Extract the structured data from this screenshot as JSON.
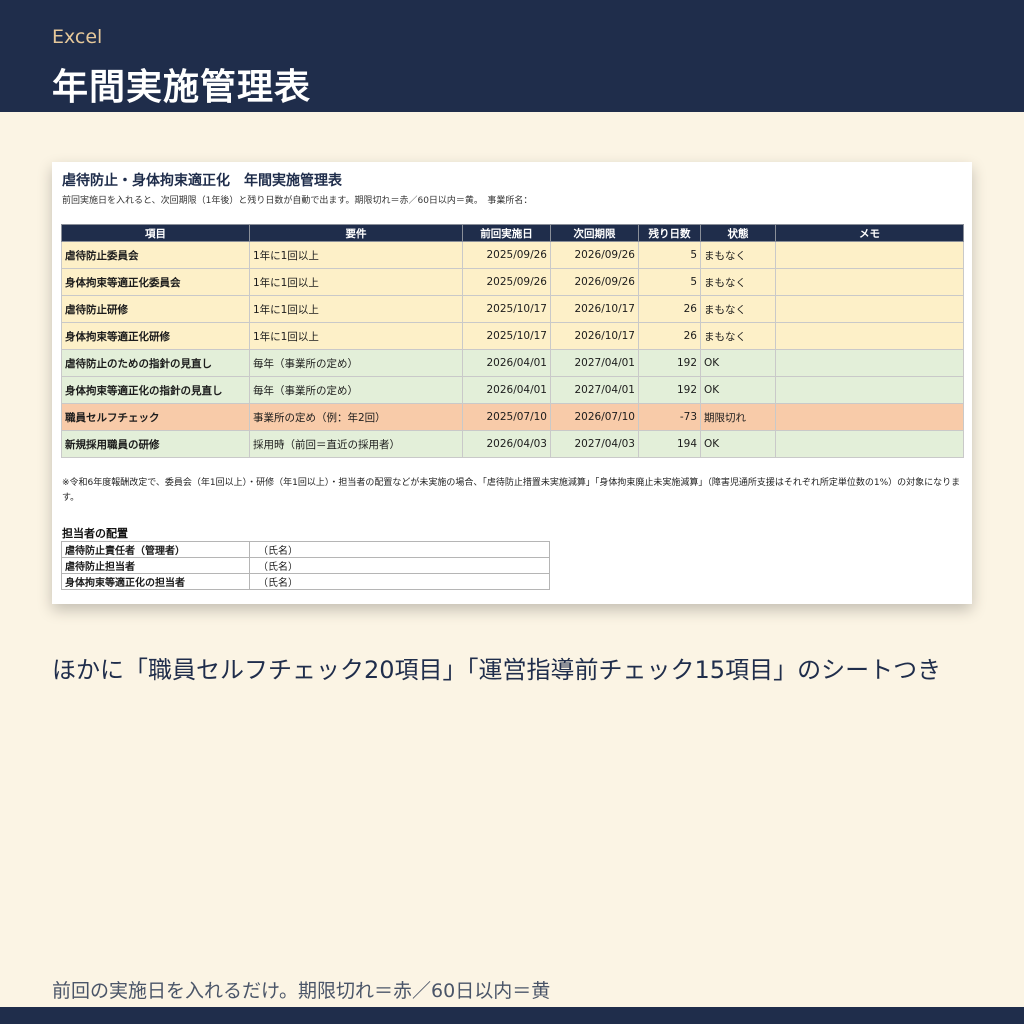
{
  "header": {
    "app": "Excel",
    "title": "年間実施管理表"
  },
  "sheet": {
    "title": "虐待防止・身体拘束適正化　年間実施管理表",
    "subtitle": "前回実施日を入れると、次回期限（1年後）と残り日数が自動で出ます。期限切れ＝赤／60日以内＝黄。　事業所名：",
    "columns": [
      "項目",
      "要件",
      "前回実施日",
      "次回期限",
      "残り日数",
      "状態",
      "メモ"
    ],
    "rows": [
      {
        "item": "虐待防止委員会",
        "req": "1年に1回以上",
        "last": "2025/09/26",
        "next": "2026/09/26",
        "days": "5",
        "status": "まもなく",
        "memo": "",
        "level": "y"
      },
      {
        "item": "身体拘束等適正化委員会",
        "req": "1年に1回以上",
        "last": "2025/09/26",
        "next": "2026/09/26",
        "days": "5",
        "status": "まもなく",
        "memo": "",
        "level": "y"
      },
      {
        "item": "虐待防止研修",
        "req": "1年に1回以上",
        "last": "2025/10/17",
        "next": "2026/10/17",
        "days": "26",
        "status": "まもなく",
        "memo": "",
        "level": "y"
      },
      {
        "item": "身体拘束等適正化研修",
        "req": "1年に1回以上",
        "last": "2025/10/17",
        "next": "2026/10/17",
        "days": "26",
        "status": "まもなく",
        "memo": "",
        "level": "y"
      },
      {
        "item": "虐待防止のための指針の見直し",
        "req": "毎年（事業所の定め）",
        "last": "2026/04/01",
        "next": "2027/04/01",
        "days": "192",
        "status": "OK",
        "memo": "",
        "level": "g"
      },
      {
        "item": "身体拘束等適正化の指針の見直し",
        "req": "毎年（事業所の定め）",
        "last": "2026/04/01",
        "next": "2027/04/01",
        "days": "192",
        "status": "OK",
        "memo": "",
        "level": "g"
      },
      {
        "item": "職員セルフチェック",
        "req": "事業所の定め（例：年2回）",
        "last": "2025/07/10",
        "next": "2026/07/10",
        "days": "-73",
        "status": "期限切れ",
        "memo": "",
        "level": "r"
      },
      {
        "item": "新規採用職員の研修",
        "req": "採用時（前回＝直近の採用者）",
        "last": "2026/04/03",
        "next": "2027/04/03",
        "days": "194",
        "status": "OK",
        "memo": "",
        "level": "g"
      }
    ],
    "note": "※令和6年度報酬改定で、委員会（年1回以上）・研修（年1回以上）・担当者の配置などが未実施の場合、「虐待防止措置未実施減算」「身体拘束廃止未実施減算」（障害児通所支援はそれぞれ所定単位数の1%）の対象になります。",
    "staff_title": "担当者の配置",
    "staff": [
      {
        "role": "虐待防止責任者（管理者）",
        "value": "（氏名）"
      },
      {
        "role": "虐待防止担当者",
        "value": "（氏名）"
      },
      {
        "role": "身体拘束等適正化の担当者",
        "value": "（氏名）"
      }
    ]
  },
  "caption": "ほかに「職員セルフチェック20項目」「運営指導前チェック15項目」のシートつき",
  "footer": "前回の実施日を入れるだけ。期限切れ＝赤／60日以内＝黄",
  "colors": {
    "navy": "#1f2d4b",
    "yellow": "#fdf0c8",
    "green": "#e3efd9",
    "red": "#f8cba9",
    "background": "#fbf4e4"
  }
}
